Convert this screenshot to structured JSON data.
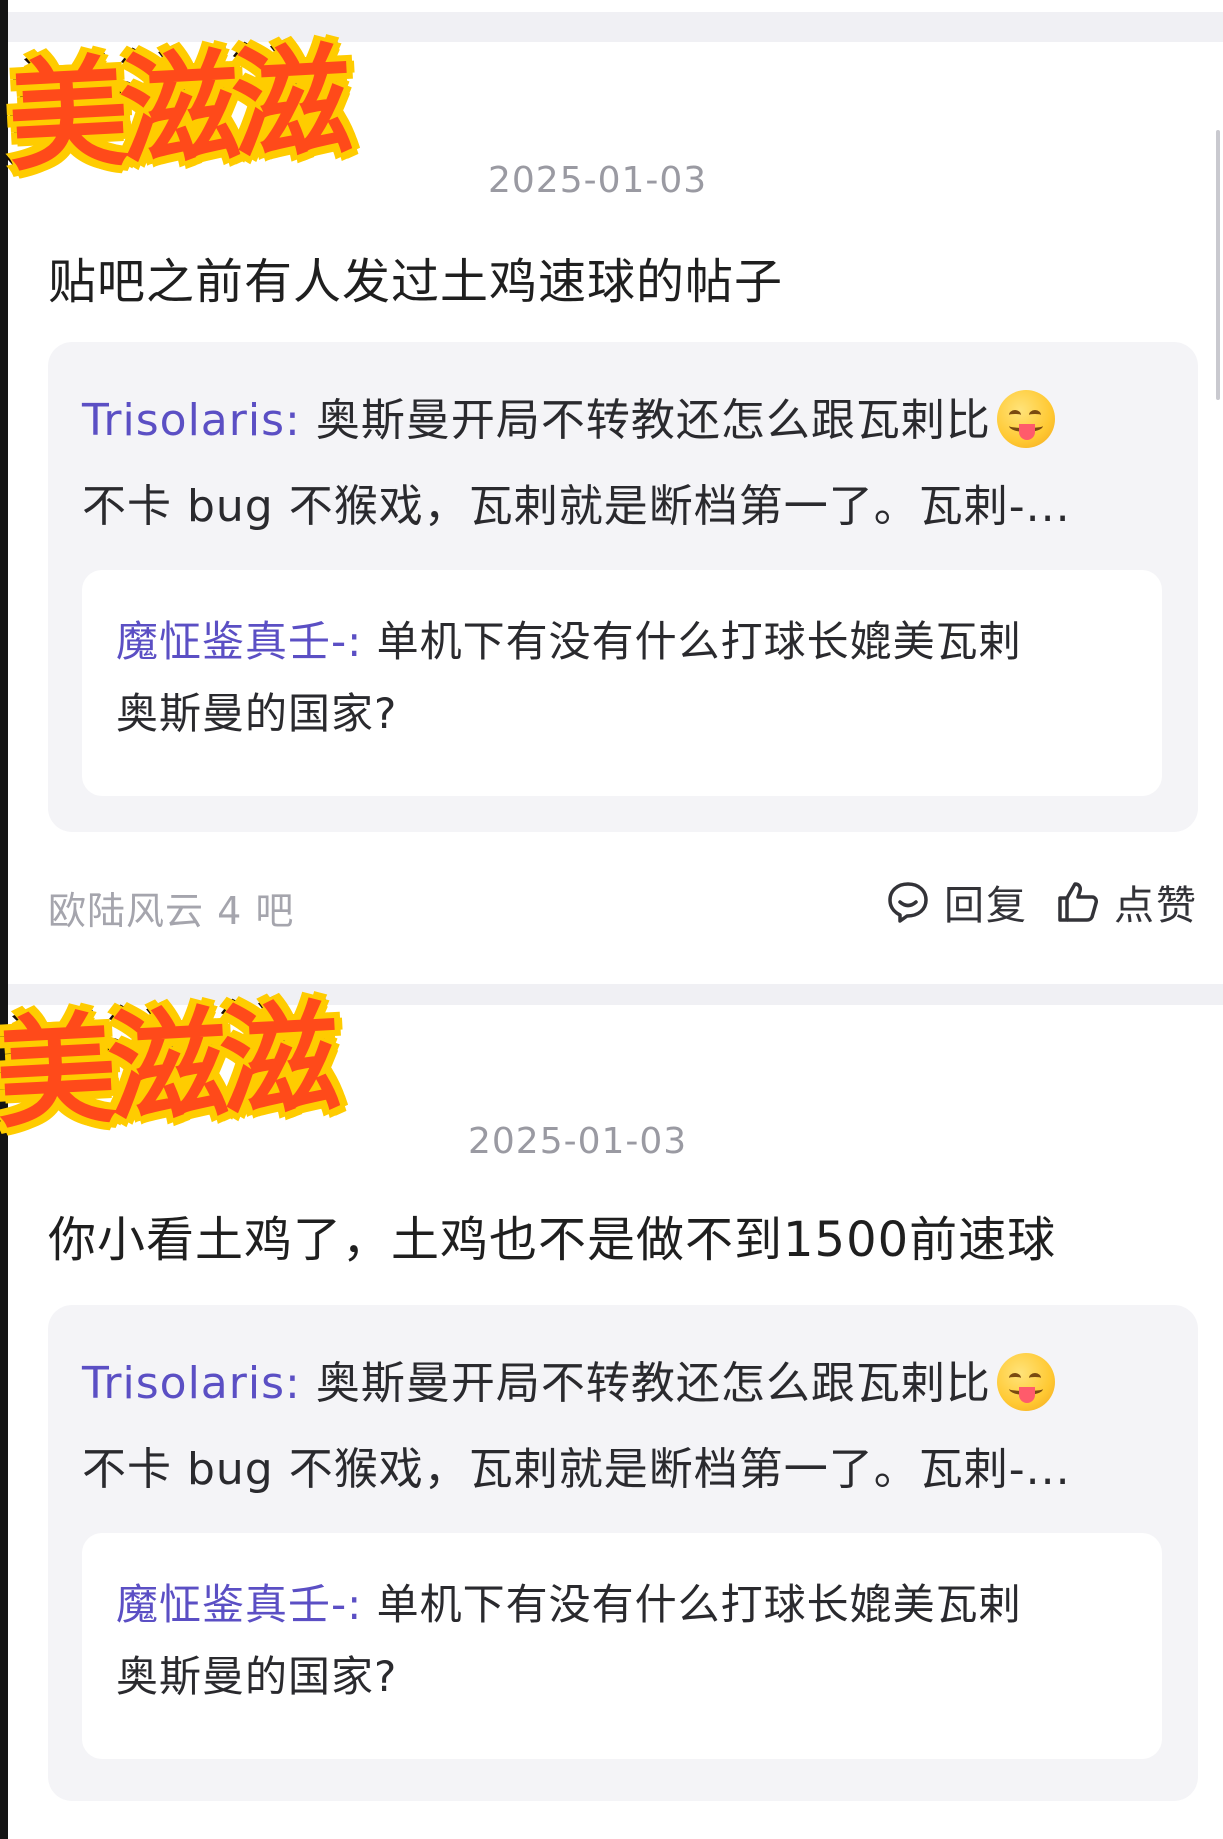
{
  "posts": [
    {
      "avatar_text": "美滋滋",
      "date": "2025-01-03",
      "text": "贴吧之前有人发过土鸡速球的帖子",
      "quote": {
        "user": "Trisolaris:",
        "line1": " 奥斯曼开局不转教还怎么跟瓦剌比",
        "line2": "不卡 bug 不猴戏，瓦剌就是断档第一了。瓦剌-...",
        "nested": {
          "user": "魔怔鉴真壬-:",
          "line1": " 单机下有没有什么打球长媲美瓦剌",
          "line2": "奥斯曼的国家?"
        }
      },
      "footer": {
        "bar": "欧陆风云 4 吧",
        "reply": "回复",
        "like": "点赞"
      }
    },
    {
      "avatar_text": "美滋滋",
      "date": "2025-01-03",
      "text": "你小看土鸡了，土鸡也不是做不到1500前速球",
      "quote": {
        "user": "Trisolaris:",
        "line1": " 奥斯曼开局不转教还怎么跟瓦剌比",
        "line2": "不卡 bug 不猴戏，瓦剌就是断档第一了。瓦剌-...",
        "nested": {
          "user": "魔怔鉴真壬-:",
          "line1": " 单机下有没有什么打球长媲美瓦剌",
          "line2": "奥斯曼的国家?"
        }
      }
    }
  ],
  "icons": [
    "smile-emoji-icon",
    "comment-icon",
    "thumbs-up-icon"
  ],
  "colors": {
    "username": "#5b4fc4",
    "muted": "#a5a5ad",
    "quote_bg": "#f4f4f7",
    "page_bg": "#f0f0f4"
  }
}
